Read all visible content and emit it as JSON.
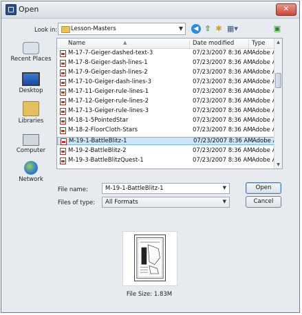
{
  "window": {
    "title": "Open",
    "close_glyph": "✕"
  },
  "toolbar": {
    "look_in_label": "Look in:",
    "look_in_value": "Lesson-Masters",
    "icons": [
      "back-icon",
      "up-folder-icon",
      "new-folder-icon",
      "views-menu-icon",
      "folder-icon"
    ]
  },
  "places": [
    {
      "label": "Recent Places",
      "icon": "recent-places-icon"
    },
    {
      "label": "Desktop",
      "icon": "desktop-icon"
    },
    {
      "label": "Libraries",
      "icon": "libraries-icon"
    },
    {
      "label": "Computer",
      "icon": "computer-icon"
    },
    {
      "label": "Network",
      "icon": "network-icon"
    }
  ],
  "file_list": {
    "columns": [
      "Name",
      "Date modified",
      "Type"
    ],
    "rows": [
      {
        "name": "M-17-7-Geiger-dashed-text-3",
        "date": "07/23/2007 8:36 AM",
        "type": "Adobe Ac"
      },
      {
        "name": "M-17-8-Geiger-dash-lines-1",
        "date": "07/23/2007 8:36 AM",
        "type": "Adobe Ac"
      },
      {
        "name": "M-17-9-Geiger-dash-lines-2",
        "date": "07/23/2007 8:36 AM",
        "type": "Adobe Ac"
      },
      {
        "name": "M-17-10-Geiger-dash-lines-3",
        "date": "07/23/2007 8:36 AM",
        "type": "Adobe Ac"
      },
      {
        "name": "M-17-11-Geiger-rule-lines-1",
        "date": "07/23/2007 8:36 AM",
        "type": "Adobe Ac"
      },
      {
        "name": "M-17-12-Geiger-rule-lines-2",
        "date": "07/23/2007 8:36 AM",
        "type": "Adobe Ac"
      },
      {
        "name": "M-17-13-Geiger-rule-lines-3",
        "date": "07/23/2007 8:36 AM",
        "type": "Adobe Ac"
      },
      {
        "name": "M-18-1-5PointedStar",
        "date": "07/23/2007 8:36 AM",
        "type": "Adobe Ac"
      },
      {
        "name": "M-18-2-FloorCloth-Stars",
        "date": "07/23/2007 8:36 AM",
        "type": "Adobe Ac"
      },
      {
        "name": "M-19-1-BattleBlitz-1",
        "date": "07/23/2007 8:36 AM",
        "type": "Adobe Ac",
        "selected": true
      },
      {
        "name": "M-19-2-BattleBlitz-2",
        "date": "07/23/2007 8:36 AM",
        "type": "Adobe Ac"
      },
      {
        "name": "M-19-3-BattleBlitzQuest-1",
        "date": "07/23/2007 8:36 AM",
        "type": "Adobe Ac"
      }
    ]
  },
  "file_name": {
    "label": "File name:",
    "value": "M-19-1-BattleBlitz-1"
  },
  "files_of_type": {
    "label": "Files of type:",
    "value": "All Formats"
  },
  "buttons": {
    "open": "Open",
    "cancel": "Cancel"
  },
  "preview": {
    "file_size": "File Size: 1.83M"
  }
}
